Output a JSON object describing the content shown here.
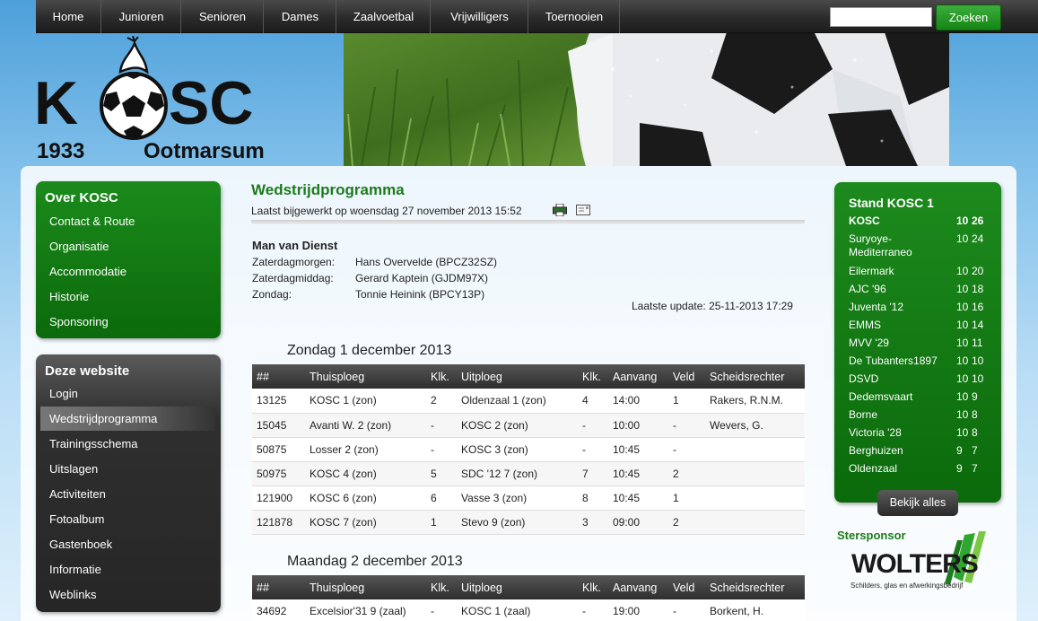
{
  "nav": {
    "items": [
      "Home",
      "Junioren",
      "Senioren",
      "Dames",
      "Zaalvoetbal",
      "Vrijwilligers",
      "Toernooien"
    ],
    "search_value": "",
    "search_button": "Zoeken"
  },
  "logo": {
    "name": "KOSC",
    "year": "1933",
    "place": "Ootmarsum"
  },
  "sidebar": {
    "about_title": "Over KOSC",
    "about_items": [
      "Contact & Route",
      "Organisatie",
      "Accommodatie",
      "Historie",
      "Sponsoring"
    ],
    "site_title": "Deze website",
    "site_items": [
      "Login",
      "Wedstrijdprogramma",
      "Trainingsschema",
      "Uitslagen",
      "Activiteiten",
      "Fotoalbum",
      "Gastenboek",
      "Informatie",
      "Weblinks"
    ],
    "active_item": "Wedstrijdprogramma"
  },
  "content": {
    "title": "Wedstrijdprogramma",
    "updated": "Laatst bijgewerkt op woensdag 27 november 2013 15:52",
    "duty_title": "Man van Dienst",
    "duty": [
      {
        "label": "Zaterdagmorgen:",
        "value": "Hans Overvelde (BPCZ32SZ)"
      },
      {
        "label": "Zaterdagmiddag:",
        "value": "Gerard Kaptein (GJDM97X)"
      },
      {
        "label": "Zondag:",
        "value": "Tonnie Heinink (BPCY13P)"
      }
    ],
    "last_update": "Laatste update: 25-11-2013 17:29",
    "columns": [
      "##",
      "Thuisploeg",
      "Klk.",
      "Uitploeg",
      "Klk.",
      "Aanvang",
      "Veld",
      "Scheidsrechter"
    ],
    "days": [
      {
        "heading": "Zondag 1 december 2013",
        "rows": [
          [
            "13125",
            "KOSC 1 (zon)",
            "2",
            "Oldenzaal 1 (zon)",
            "4",
            "14:00",
            "1",
            "Rakers, R.N.M."
          ],
          [
            "15045",
            "Avanti W. 2 (zon)",
            "-",
            "KOSC 2 (zon)",
            "-",
            "10:00",
            "-",
            "Wevers, G."
          ],
          [
            "50875",
            "Losser 2 (zon)",
            "-",
            "KOSC 3 (zon)",
            "-",
            "10:45",
            "-",
            ""
          ],
          [
            "50975",
            "KOSC 4 (zon)",
            "5",
            "SDC '12 7 (zon)",
            "7",
            "10:45",
            "2",
            ""
          ],
          [
            "121900",
            "KOSC 6 (zon)",
            "6",
            "Vasse 3 (zon)",
            "8",
            "10:45",
            "1",
            ""
          ],
          [
            "121878",
            "KOSC 7 (zon)",
            "1",
            "Stevo 9 (zon)",
            "3",
            "09:00",
            "2",
            ""
          ]
        ]
      },
      {
        "heading": "Maandag 2 december 2013",
        "rows": [
          [
            "34692",
            "Excelsior'31 9 (zaal)",
            "-",
            "KOSC 1 (zaal)",
            "-",
            "19:00",
            "-",
            "Borkent, H."
          ]
        ]
      }
    ]
  },
  "standings": {
    "title": "Stand KOSC 1",
    "rows": [
      {
        "team": "KOSC",
        "played": "10",
        "points": "26",
        "highlight": true
      },
      {
        "team": "Suryoye-Mediterraneo",
        "played": "10",
        "points": "24"
      },
      {
        "team": "Eilermark",
        "played": "10",
        "points": "20"
      },
      {
        "team": "AJC '96",
        "played": "10",
        "points": "18"
      },
      {
        "team": "Juventa '12",
        "played": "10",
        "points": "16"
      },
      {
        "team": "EMMS",
        "played": "10",
        "points": "14"
      },
      {
        "team": "MVV '29",
        "played": "10",
        "points": "11"
      },
      {
        "team": "De Tubanters1897",
        "played": "10",
        "points": "10"
      },
      {
        "team": "DSVD",
        "played": "10",
        "points": "10"
      },
      {
        "team": "Dedemsvaart",
        "played": "10",
        "points": "9"
      },
      {
        "team": "Borne",
        "played": "10",
        "points": "8"
      },
      {
        "team": "Victoria '28",
        "played": "10",
        "points": "8"
      },
      {
        "team": "Berghuizen",
        "played": "9",
        "points": "7"
      },
      {
        "team": "Oldenzaal",
        "played": "9",
        "points": "7"
      }
    ],
    "more_button": "Bekijk alles"
  },
  "sponsor": {
    "title": "Stersponsor",
    "name": "WOLTERS",
    "tagline": "Schilders, glas en afwerkingsbedrijf"
  },
  "colors": {
    "brand_green": "#1d7a1d",
    "nav_dark": "#2b2b2b"
  }
}
